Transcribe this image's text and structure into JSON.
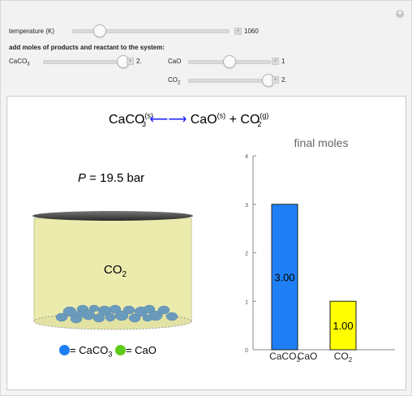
{
  "controls": {
    "temperature_label": "temperature (K)",
    "temperature_value": "1060",
    "temperature_fraction": 0.17,
    "section_label": "add moles of products and reactant to the system:",
    "caco3_label": "CaCO",
    "caco3_sub": "3",
    "caco3_value": "2.",
    "caco3_fraction": 0.98,
    "cao_label": "CaO",
    "cao_value": "1",
    "cao_fraction": 0.5,
    "co2_label": "CO",
    "co2_sub": "2",
    "co2_value": "2.",
    "co2_fraction": 0.98
  },
  "panel": {
    "equation": {
      "caco3": "CaCO",
      "caco3_sub": "3",
      "caco3_phase": "(s)",
      "arrow": "⟵⟶",
      "cao": "CaO",
      "cao_phase": "(s)",
      "plus": "+",
      "co2": "CO",
      "co2_sub": "2",
      "co2_phase": "(g)"
    },
    "pressure_label": "P",
    "pressure_text": " = 19.5 bar",
    "vessel_gas_label": "CO",
    "vessel_gas_sub": "2",
    "legend": {
      "caco3_text": "= CaCO",
      "caco3_sub": "3",
      "cao_text": "= CaO",
      "caco3_color": "#1e7ff5",
      "cao_color": "#5fcb1a"
    }
  },
  "chart_data": {
    "type": "bar",
    "title": "final moles",
    "categories": [
      "CaCO3",
      "CaO",
      "CO2"
    ],
    "category_labels": [
      "CaCO",
      "CaO",
      "CO"
    ],
    "category_subs": [
      "3",
      "",
      "2"
    ],
    "values": [
      3.0,
      0.0,
      1.0
    ],
    "value_labels": [
      "3.00",
      "",
      "1.00"
    ],
    "colors": [
      "#1e7ff5",
      "#5fcb1a",
      "#ffff00"
    ],
    "ylim": [
      0,
      4
    ],
    "yticks": [
      "0",
      "1",
      "2",
      "3",
      "4"
    ]
  }
}
